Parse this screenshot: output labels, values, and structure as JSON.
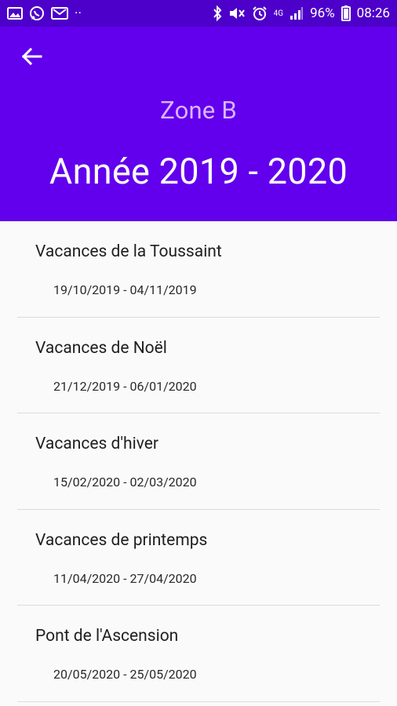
{
  "status_bar": {
    "battery": "96%",
    "time": "08:26",
    "network": "4G",
    "dots": "··",
    "icons_left": [
      "gallery-icon",
      "whatsapp-icon",
      "gmail-icon"
    ],
    "icons_right": [
      "bluetooth-icon",
      "mute-icon",
      "alarm-icon",
      "signal-icon",
      "battery-icon"
    ],
    "colors": {
      "background": "#4d00c9"
    }
  },
  "header": {
    "back_icon": "arrow-left-icon",
    "zone": "Zone B",
    "year": "Année 2019 - 2020",
    "colors": {
      "background": "#6200ee",
      "zone_text": "#d9b6ff",
      "year_text": "#ffffff"
    }
  },
  "holidays": [
    {
      "name": "Vacances de la Toussaint",
      "dates": "19/10/2019 - 04/11/2019"
    },
    {
      "name": "Vacances de Noël",
      "dates": "21/12/2019 - 06/01/2020"
    },
    {
      "name": "Vacances d'hiver",
      "dates": "15/02/2020 - 02/03/2020"
    },
    {
      "name": "Vacances de printemps",
      "dates": "11/04/2020 - 27/04/2020"
    },
    {
      "name": "Pont de l'Ascension",
      "dates": "20/05/2020 - 25/05/2020"
    }
  ]
}
